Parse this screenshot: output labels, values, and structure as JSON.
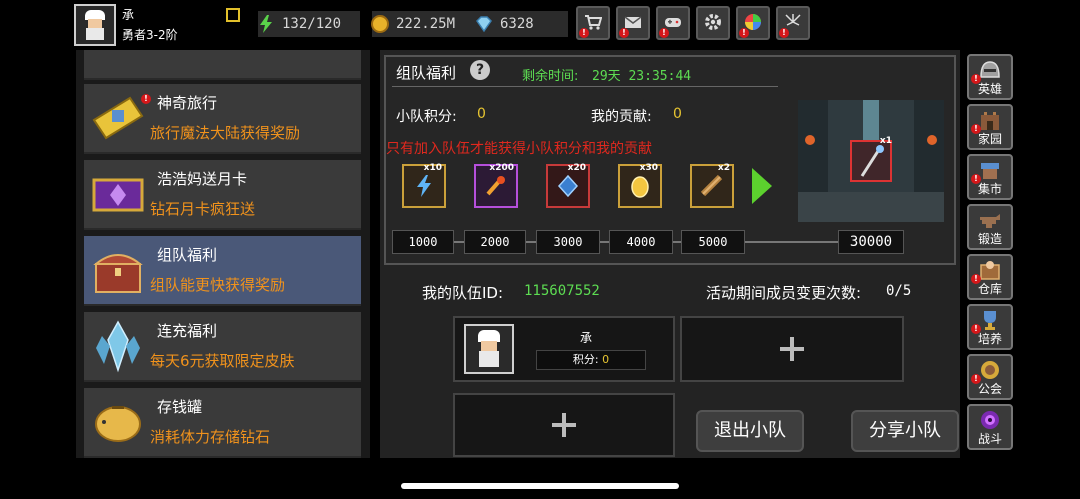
{
  "player": {
    "name": "承",
    "rank": "勇者3-2阶"
  },
  "resources": [
    {
      "icon": "energy-icon",
      "value": "132/120"
    },
    {
      "icon": "gold-coin-icon",
      "value": "222.25M"
    },
    {
      "icon": "gem-icon",
      "value": "6328"
    }
  ],
  "top_buttons": [
    {
      "icon": "shop-cart-icon"
    },
    {
      "icon": "mail-icon"
    },
    {
      "icon": "gamepad-icon"
    },
    {
      "icon": "settings-gear-icon"
    },
    {
      "icon": "color-wheel-icon"
    },
    {
      "icon": "fireworks-icon"
    }
  ],
  "left_list": [
    {
      "title": "神奇旅行",
      "desc": "旅行魔法大陆获得奖励",
      "icon": "golden-ticket-icon"
    },
    {
      "title": "浩浩妈送月卡",
      "desc": "钻石月卡疯狂送",
      "icon": "monthly-card-icon"
    },
    {
      "title": "组队福利",
      "desc": "组队能更快获得奖励",
      "icon": "treasure-chest-icon",
      "selected": true
    },
    {
      "title": "连充福利",
      "desc": "每天6元获取限定皮肤",
      "icon": "ice-crystal-icon"
    },
    {
      "title": "存钱罐",
      "desc": "消耗体力存储钻石",
      "icon": "piggy-bank-icon"
    }
  ],
  "event": {
    "title": "组队福利",
    "time_label": "剩余时间:",
    "time_value": "29天 23:35:44",
    "team_points_label": "小队积分:",
    "team_points_value": "0",
    "my_contribution_label": "我的贡献:",
    "my_contribution_value": "0",
    "warning": "只有加入队伍才能获得小队积分和我的贡献",
    "rewards": [
      {
        "icon": "lightning-icon",
        "count": "x10"
      },
      {
        "icon": "fire-sword-icon",
        "count": "x200"
      },
      {
        "icon": "blue-rune-icon",
        "count": "x20"
      },
      {
        "icon": "golden-egg-icon",
        "count": "x30"
      },
      {
        "icon": "scroll-icon",
        "count": "x2"
      }
    ],
    "milestones": [
      "1000",
      "2000",
      "3000",
      "4000",
      "5000"
    ],
    "final_milestone": "30000",
    "scene_reward_count": "x1"
  },
  "team": {
    "id_label": "我的队伍ID:",
    "id_value": "115607552",
    "change_label": "活动期间成员变更次数:",
    "change_value": "0/5",
    "member": {
      "name": "承",
      "score_label": "积分:",
      "score_value": "0"
    },
    "quit_button": "退出小队",
    "share_button": "分享小队"
  },
  "side_nav": [
    {
      "label": "英雄",
      "icon": "hero-helmet-icon",
      "alert": true
    },
    {
      "label": "家园",
      "icon": "castle-icon",
      "alert": true
    },
    {
      "label": "集市",
      "icon": "market-stall-icon",
      "alert": true
    },
    {
      "label": "锻造",
      "icon": "anvil-icon",
      "alert": false
    },
    {
      "label": "仓库",
      "icon": "warehouse-chest-icon",
      "alert": true
    },
    {
      "label": "培养",
      "icon": "trophy-icon",
      "alert": true
    },
    {
      "label": "公会",
      "icon": "guild-banner-icon",
      "alert": true
    },
    {
      "label": "战斗",
      "icon": "battle-portal-icon",
      "alert": false
    }
  ],
  "colors": {
    "accent_green": "#5ddc52",
    "accent_orange": "#f0921c",
    "accent_yellow": "#e7c531",
    "warning_red": "#e0281e",
    "selected_item": "#4a5878"
  }
}
